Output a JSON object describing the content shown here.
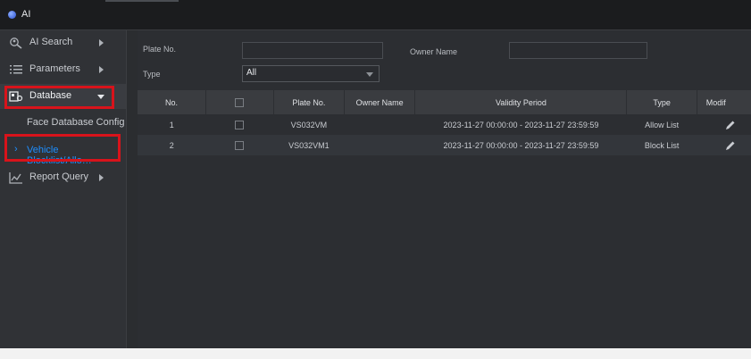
{
  "app": {
    "title": "AI"
  },
  "sidebar": {
    "items": [
      {
        "label": "AI Search",
        "icon": "search-face-icon"
      },
      {
        "label": "Parameters",
        "icon": "list-icon"
      },
      {
        "label": "Database",
        "icon": "database-icon",
        "expanded": true
      },
      {
        "label": "Report Query",
        "icon": "chart-icon"
      }
    ],
    "sub_items": [
      {
        "label": "Face Database Config"
      },
      {
        "label": "Vehicle Blocklist/Allo…",
        "active": true
      }
    ]
  },
  "filters": {
    "plate_label": "Plate No.",
    "plate_value": "",
    "owner_label": "Owner Name",
    "owner_value": "",
    "type_label": "Type",
    "type_value": "All"
  },
  "table": {
    "headers": [
      "No.",
      "",
      "Plate No.",
      "Owner Name",
      "Validity Period",
      "Type",
      "Modif"
    ],
    "rows": [
      {
        "no": "1",
        "plate": "VS032VM",
        "owner": "",
        "validity": "2023-11-27 00:00:00 - 2023-11-27 23:59:59",
        "type": "Allow List"
      },
      {
        "no": "2",
        "plate": "VS032VM1",
        "owner": "",
        "validity": "2023-11-27 00:00:00 - 2023-11-27 23:59:59",
        "type": "Block List"
      }
    ]
  },
  "colors": {
    "highlight": "#d8131b",
    "active_link": "#1e8fff"
  }
}
